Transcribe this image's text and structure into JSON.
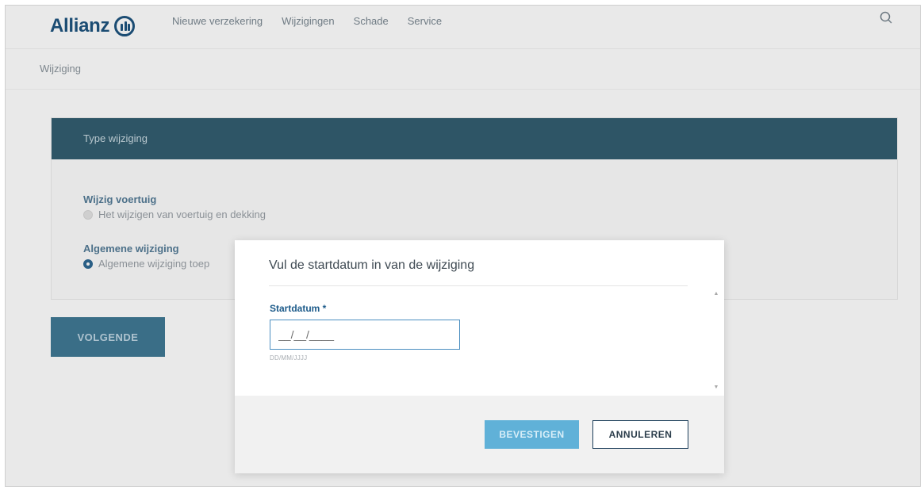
{
  "brand": {
    "logo_text": "Allianz"
  },
  "nav": {
    "items": [
      "Nieuwe verzekering",
      "Wijzigingen",
      "Schade",
      "Service"
    ]
  },
  "breadcrumb": "Wijziging",
  "card": {
    "title": "Type wijziging",
    "group1": {
      "title": "Wijzig voertuig",
      "option": "Het wijzigen van voertuig en dekking",
      "selected": false
    },
    "group2": {
      "title": "Algemene wijziging",
      "option": "Algemene wijziging toep",
      "selected": true
    }
  },
  "next_button": "VOLGENDE",
  "modal": {
    "title": "Vul de startdatum in van de wijziging",
    "field_label": "Startdatum *",
    "input_value": "__/__/____",
    "hint": "DD/MM/JJJJ",
    "confirm_label": "BEVESTIGEN",
    "cancel_label": "ANNULEREN"
  },
  "colors": {
    "brand_blue": "#1b4c73",
    "card_header": "#2e5566",
    "confirm_button": "#60b1d8"
  }
}
